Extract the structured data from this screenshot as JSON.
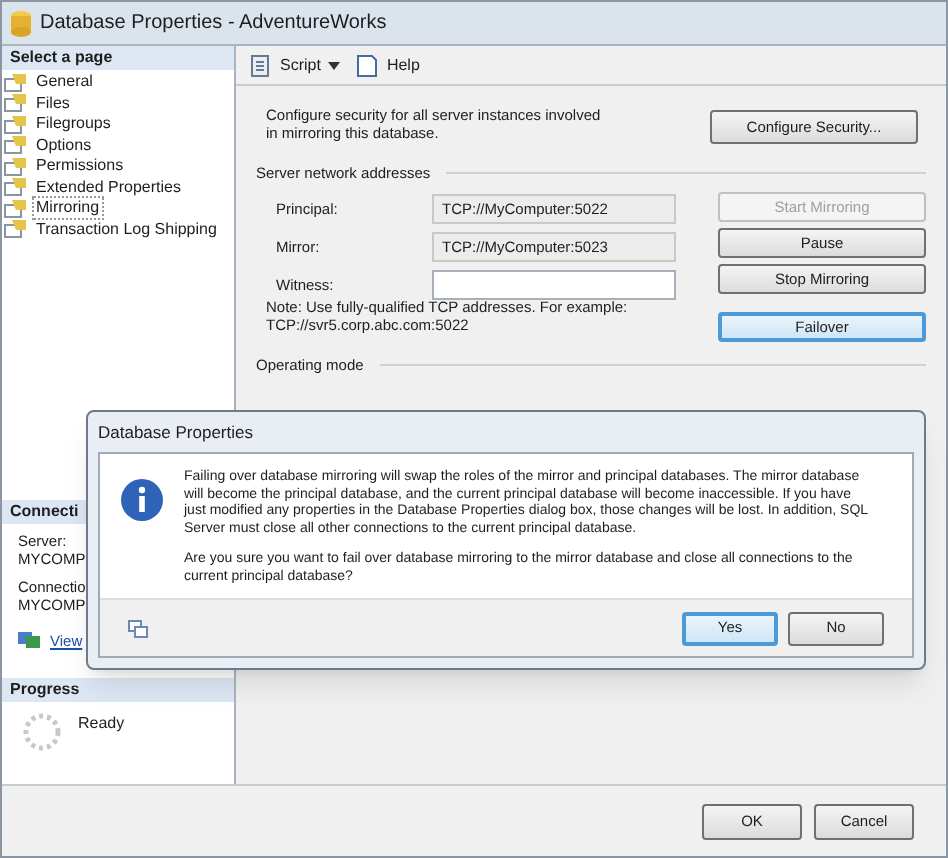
{
  "window": {
    "title": "Database Properties - AdventureWorks"
  },
  "sidebar": {
    "header": "Select a page",
    "items": [
      {
        "label": "General",
        "selected": false
      },
      {
        "label": "Files",
        "selected": false
      },
      {
        "label": "Filegroups",
        "selected": false
      },
      {
        "label": "Options",
        "selected": false
      },
      {
        "label": "Permissions",
        "selected": false
      },
      {
        "label": "Extended Properties",
        "selected": false
      },
      {
        "label": "Mirroring",
        "selected": true
      },
      {
        "label": "Transaction Log Shipping",
        "selected": false
      }
    ]
  },
  "connection": {
    "header": "Connecti",
    "server_label": "Server:",
    "server_value": "MYCOMP",
    "connection_label": "Connectio",
    "connection_value": "MYCOMP",
    "link": "View"
  },
  "progress": {
    "header": "Progress",
    "status": "Ready"
  },
  "toolbar": {
    "script": "Script",
    "help": "Help"
  },
  "mirroring": {
    "security_text": "Configure security for all server instances involved in mirroring this database.",
    "configure_button": "Configure Security...",
    "addresses_header": "Server network addresses",
    "fields": [
      {
        "label": "Principal:",
        "value": "TCP://MyComputer:5022",
        "readonly": true
      },
      {
        "label": "Mirror:",
        "value": "TCP://MyComputer:5023",
        "readonly": true
      },
      {
        "label": "Witness:",
        "readonly": false
      }
    ],
    "buttons": [
      {
        "label": "Start Mirroring",
        "disabled": true,
        "focused": false
      },
      {
        "label": "Pause",
        "disabled": false,
        "focused": false
      },
      {
        "label": "Stop Mirroring",
        "disabled": false,
        "focused": false
      },
      {
        "label": "Failover",
        "disabled": false,
        "focused": true
      }
    ],
    "note": "Note: Use fully-qualified TCP addresses. For example: TCP://svr5.corp.abc.com:5022",
    "operating_mode": "Operating mode"
  },
  "dialog": {
    "title": "Database Properties",
    "message": "Failing over database mirroring will swap the roles of the mirror and principal databases. The mirror database will become the principal database, and the current principal database will become inaccessible. If you have just modified any properties in the Database Properties dialog box, those changes will be lost. In addition, SQL Server must close all other connections to the current principal database.",
    "question": "Are you sure you want to fail over database mirroring to the mirror database and close all connections to the current principal database?",
    "buttons": [
      {
        "label": "Yes",
        "focused": true
      },
      {
        "label": "No",
        "focused": false
      }
    ]
  },
  "buttons": [
    "OK",
    "Cancel"
  ]
}
